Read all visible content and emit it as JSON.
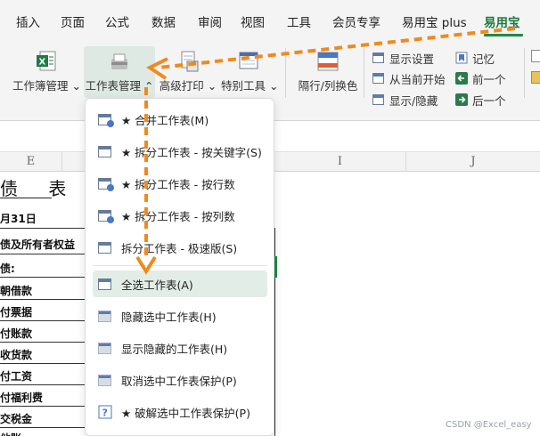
{
  "tabs": [
    "插入",
    "页面",
    "公式",
    "数据",
    "审阅",
    "视图",
    "工具",
    "会员专享",
    "易用宝 plus",
    "易用宝"
  ],
  "active_tab": "易用宝",
  "ribbon": {
    "workbook_mgmt": "工作簿管理",
    "sheet_mgmt": "工作表管理",
    "advanced_print": "高级打印",
    "special_tools": "特别工具",
    "row_col_color": "隔行/列换色",
    "display_settings": "显示设置",
    "from_current_start": "从当前开始",
    "show_hide": "显示/隐藏",
    "remember": "记忆",
    "prev": "前一个",
    "next": "后一个"
  },
  "columns": [
    "E",
    "I",
    "J"
  ],
  "sheet": {
    "title": "债 表",
    "date": "月31日",
    "rows": [
      "债及所有者权益",
      "债:",
      "朝借款",
      "付票据",
      "付账款",
      "收货款",
      "付工资",
      "付福利费",
      "交税金",
      "他账"
    ]
  },
  "menu": {
    "items": [
      {
        "label": "★ 合并工作表(M)",
        "icon": "merge-sheets-icon"
      },
      {
        "label": "★ 拆分工作表 - 按关键字(S)",
        "icon": "split-by-key-icon"
      },
      {
        "label": "★ 拆分工作表 - 按行数",
        "icon": "split-by-rows-icon"
      },
      {
        "label": "★ 拆分工作表 - 按列数",
        "icon": "split-by-cols-icon"
      },
      {
        "label": "拆分工作表 - 极速版(S)",
        "icon": "split-fast-icon"
      },
      {
        "label": "全选工作表(A)",
        "icon": "select-all-sheets-icon"
      },
      {
        "label": "隐藏选中工作表(H)",
        "icon": "hide-sheets-icon"
      },
      {
        "label": "显示隐藏的工作表(H)",
        "icon": "show-hidden-sheets-icon"
      },
      {
        "label": "取消选中工作表保护(P)",
        "icon": "unprotect-sheets-icon"
      },
      {
        "label": "★ 破解选中工作表保护(P)",
        "icon": "crack-protection-icon"
      }
    ],
    "highlighted_index": 5
  },
  "watermark": "CSDN @Excel_easy",
  "colors": {
    "accent_green": "#1e8a47",
    "arrow_orange": "#f08a1c",
    "highlight": "#e3ede7"
  }
}
